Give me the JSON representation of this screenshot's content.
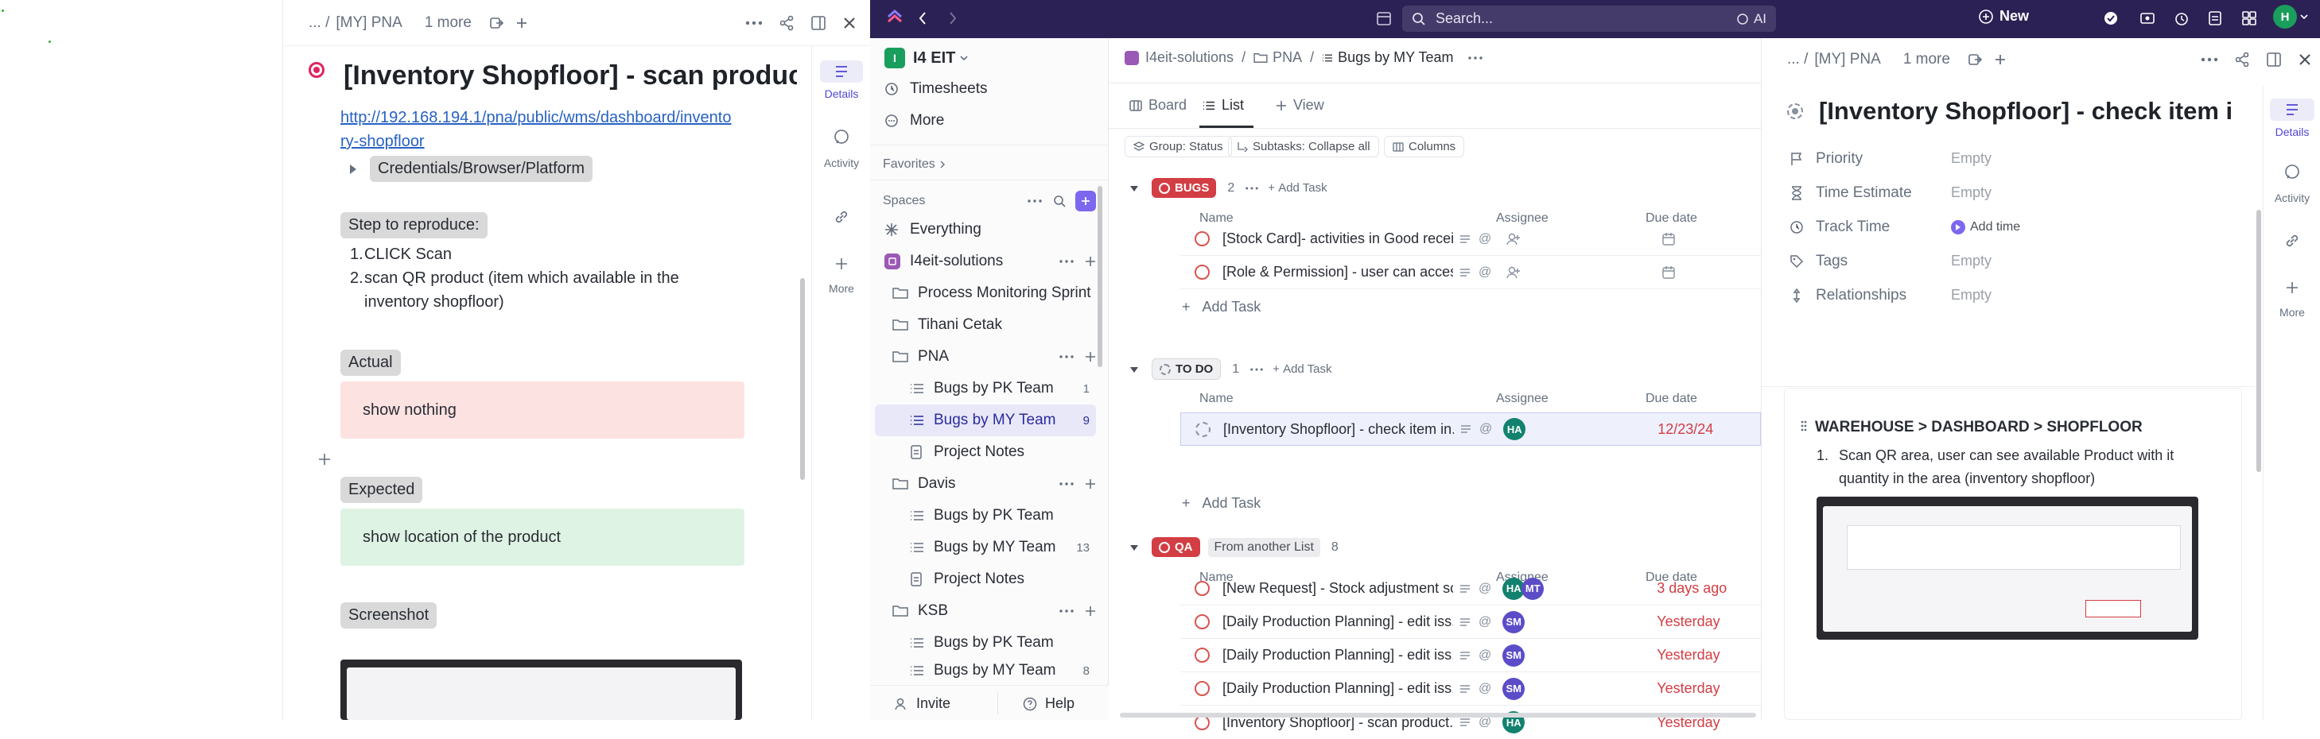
{
  "left_panel": {
    "breadcrumb_prefix": "... /",
    "breadcrumb": "[MY] PNA",
    "more": "1 more",
    "title": "[Inventory Shopfloor] - scan produc...",
    "link": "http://192.168.194.1/pna/public/wms/dashboard/inventory-shopfloor",
    "link_line1": "http://192.168.194.1/pna/public/wms/dashboard/invento",
    "link_line2": "ry-shopfloor",
    "toggle_label": "Credentials/Browser/Platform",
    "step_heading": "Step to reproduce:",
    "steps": [
      "CLICK Scan",
      "scan QR product (item which available in the",
      "inventory shopfloor)"
    ],
    "actual_heading": "Actual",
    "actual_text": "show nothing",
    "expected_heading": "Expected",
    "expected_text": "show location of the product",
    "screenshot_heading": "Screenshot",
    "rail": {
      "details": "Details",
      "activity": "Activity",
      "more": "More"
    }
  },
  "topbar": {
    "search_placeholder": "Search...",
    "ai": "AI",
    "new": "New",
    "avatar": "H"
  },
  "sidebar": {
    "workspace_badge": "I",
    "workspace": "I4 EIT",
    "items_top": [
      "Timesheets",
      "More"
    ],
    "favorites": "Favorites",
    "spaces": "Spaces",
    "everything": "Everything",
    "space": "I4eit-solutions",
    "tree": [
      {
        "label": "Process Monitoring Sprint",
        "type": "folder"
      },
      {
        "label": "Tihani Cetak",
        "type": "folder"
      },
      {
        "label": "PNA",
        "type": "folder"
      },
      {
        "label": "Bugs by PK Team",
        "type": "list",
        "count": "1"
      },
      {
        "label": "Bugs by MY Team",
        "type": "list",
        "count": "9"
      },
      {
        "label": "Project Notes",
        "type": "doc"
      },
      {
        "label": "Davis",
        "type": "folder"
      },
      {
        "label": "Bugs by PK Team",
        "type": "list",
        "count": ""
      },
      {
        "label": "Bugs by MY Team",
        "type": "list",
        "count": "13"
      },
      {
        "label": "Project Notes",
        "type": "doc"
      },
      {
        "label": "KSB",
        "type": "folder"
      },
      {
        "label": "Bugs by PK Team",
        "type": "list",
        "count": ""
      },
      {
        "label": "Bugs by MY Team",
        "type": "list",
        "count": "8"
      }
    ],
    "invite": "Invite",
    "help": "Help"
  },
  "mid": {
    "crumb1": "I4eit-solutions",
    "crumb2": "PNA",
    "crumb3": "Bugs by MY Team",
    "tabs": [
      "Board",
      "List",
      "View"
    ],
    "filters": [
      "Group: Status",
      "Subtasks: Collapse all",
      "Columns"
    ],
    "col_name": "Name",
    "col_assignee": "Assignee",
    "col_due": "Due date",
    "add_task": "Add Task",
    "groups": [
      {
        "label": "BUGS",
        "count": "2",
        "color": "#d33d44"
      },
      {
        "label": "TO DO",
        "count": "1",
        "color": "#87909e"
      },
      {
        "label": "QA",
        "count": "8",
        "color": "#d33d44",
        "note": "From another List"
      }
    ],
    "bugs_rows": [
      {
        "name": "[Stock Card]- activities in Good recei..."
      },
      {
        "name": "[Role & Permission] - user can access sc..."
      }
    ],
    "todo_rows": [
      {
        "name": "[Inventory Shopfloor] - check item in...",
        "assignee": "HA",
        "due": "12/23/24"
      }
    ],
    "qa_rows": [
      {
        "name": "[New Request] - Stock adjustment sc...",
        "assignee": "HA",
        "assignee2": "MT",
        "due": "3 days ago"
      },
      {
        "name": "[Daily Production Planning] - edit iss...",
        "assignee": "SM",
        "due": "Yesterday"
      },
      {
        "name": "[Daily Production Planning] - edit iss...",
        "assignee": "SM",
        "due": "Yesterday"
      },
      {
        "name": "[Daily Production Planning] - edit iss...",
        "assignee": "SM",
        "due": "Yesterday"
      },
      {
        "name": "[Inventory Shopfloor] - scan product...",
        "assignee": "HA",
        "due": "Yesterday"
      }
    ]
  },
  "right_panel": {
    "breadcrumb_prefix": "... /",
    "breadcrumb": "[MY] PNA",
    "more": "1 more",
    "title": "[Inventory Shopfloor] - check item i...",
    "props": [
      {
        "label": "Priority",
        "value": "Empty"
      },
      {
        "label": "Time Estimate",
        "value": "Empty"
      },
      {
        "label": "Track Time",
        "value": "Add time"
      },
      {
        "label": "Tags",
        "value": "Empty"
      },
      {
        "label": "Relationships",
        "value": "Empty"
      }
    ],
    "section_title": "WAREHOUSE > DASHBOARD > SHOPFLOOR",
    "step1_line1": "Scan QR area,  user can see available Product with it",
    "step1_line2": "quantity in the area (inventory shopfloor)",
    "rail": {
      "details": "Details",
      "activity": "Activity",
      "more": "More"
    }
  },
  "colors": {
    "accent": "#7b68ee",
    "topbar": "#2c2154",
    "overdue": "#d33d44"
  }
}
